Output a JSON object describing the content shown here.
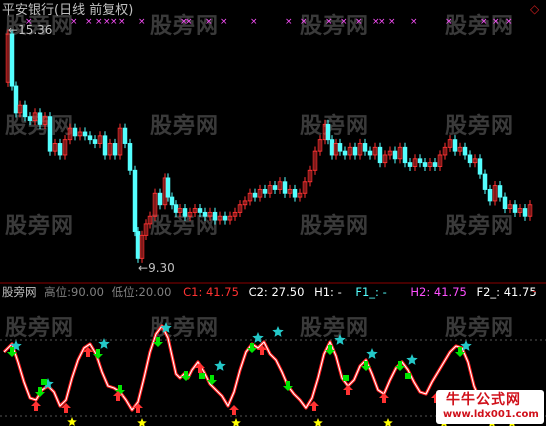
{
  "main_panel": {
    "title": "平安银行(日线 前复权)",
    "high_label": "15.36",
    "low_label": "9.30",
    "marker_glyph": "×",
    "corner_glyph": "◇"
  },
  "indicator_panel": {
    "name": "股旁网",
    "gaowei_label": "高位:",
    "gaowei_value": "90.00",
    "diwei_label": "低位:",
    "diwei_value": "20.00",
    "c1_label": "C1:",
    "c1_value": "41.75",
    "c2_label": "C2:",
    "c2_value": "27.50",
    "h1_label": "H1:",
    "h1_value": "-",
    "f1_label": "F1_:",
    "f1_value": "-",
    "h2_label": "H2:",
    "h2_value": "41.75",
    "f2_label": "F2_:",
    "f2_value": "41.75",
    "close_glyph": "-"
  },
  "watermarks": [
    "股旁网",
    "股旁网",
    "股旁网",
    "股旁网",
    "股旁网",
    "股旁网",
    "股旁网",
    "股旁网",
    "股旁网",
    "股旁网",
    "股旁网",
    "股旁网"
  ],
  "logo_text": "牛牛公式网",
  "logo_url": "www.ldx001.com",
  "colors": {
    "up": "#ff3232",
    "down": "#54ffff",
    "title": "#c0c0c0",
    "magenta": "#ff50ff",
    "green": "#00e600",
    "cyan_star": "#24c8c8",
    "yellow_star": "#ffff00",
    "line_white": "#ffffff",
    "line_red": "#ff1e1e",
    "separator": "#8b0000"
  }
}
